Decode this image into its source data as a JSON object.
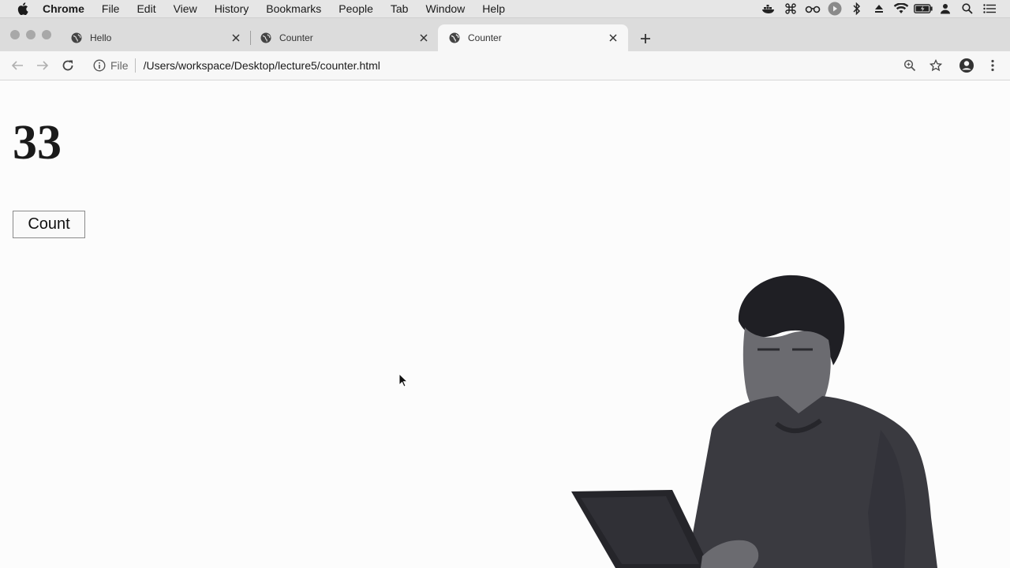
{
  "menubar": {
    "app_name": "Chrome",
    "items": [
      "File",
      "Edit",
      "View",
      "History",
      "Bookmarks",
      "People",
      "Tab",
      "Window",
      "Help"
    ],
    "status_icons": [
      "docker-icon",
      "command-icon",
      "glasses-icon",
      "play-icon",
      "bluetooth-icon",
      "eject-icon",
      "wifi-icon",
      "battery-icon",
      "user-icon",
      "spotlight-search-icon",
      "notification-center-icon"
    ]
  },
  "tabs": [
    {
      "label": "Hello",
      "active": false
    },
    {
      "label": "Counter",
      "active": false
    },
    {
      "label": "Counter",
      "active": true
    }
  ],
  "toolbar": {
    "scheme_label": "File",
    "url": "/Users/workspace/Desktop/lecture5/counter.html"
  },
  "page": {
    "counter_value": "33",
    "count_button_label": "Count"
  },
  "colors": {
    "menubar_bg": "#e6e6e6",
    "tabstrip_bg": "#dcdcdc",
    "toolbar_bg": "#f7f7f7",
    "page_bg": "#fcfcfc"
  }
}
